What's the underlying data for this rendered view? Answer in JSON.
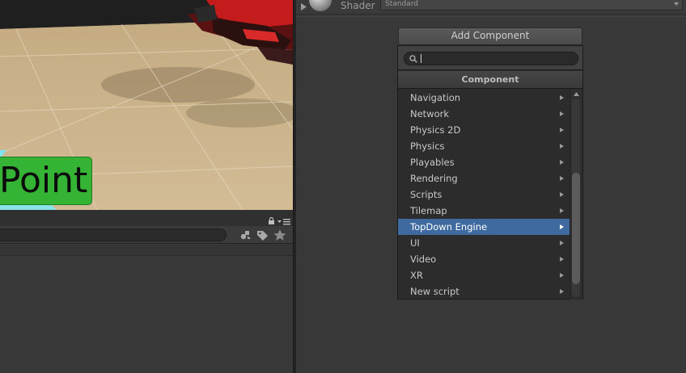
{
  "scene": {
    "label_text": "Point"
  },
  "inspector": {
    "shader_label": "Shader",
    "shader_value": "Standard"
  },
  "add_component": {
    "button_label": "Add Component",
    "search_value": "",
    "header": "Component",
    "items": [
      {
        "label": "Navigation",
        "selected": false
      },
      {
        "label": "Network",
        "selected": false
      },
      {
        "label": "Physics 2D",
        "selected": false
      },
      {
        "label": "Physics",
        "selected": false
      },
      {
        "label": "Playables",
        "selected": false
      },
      {
        "label": "Rendering",
        "selected": false
      },
      {
        "label": "Scripts",
        "selected": false
      },
      {
        "label": "Tilemap",
        "selected": false
      },
      {
        "label": "TopDown Engine",
        "selected": true
      },
      {
        "label": "UI",
        "selected": false
      },
      {
        "label": "Video",
        "selected": false
      },
      {
        "label": "XR",
        "selected": false
      },
      {
        "label": "New script",
        "selected": false
      }
    ],
    "scroll_position": 0.62
  },
  "colors": {
    "selection": "#3e6a9f",
    "panel_bg": "#383838",
    "scene_floor": "#c9b189",
    "label_green": "#35b335"
  }
}
